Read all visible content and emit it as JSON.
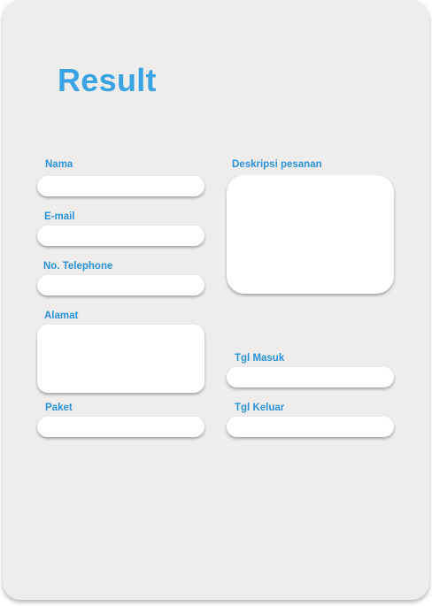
{
  "page": {
    "title": "Result"
  },
  "form": {
    "nama": {
      "label": "Nama",
      "value": ""
    },
    "email": {
      "label": "E-mail",
      "value": ""
    },
    "telephone": {
      "label": "No. Telephone",
      "value": ""
    },
    "alamat": {
      "label": "Alamat",
      "value": ""
    },
    "paket": {
      "label": "Paket",
      "value": ""
    },
    "deskripsi": {
      "label": "Deskripsi pesanan",
      "value": ""
    },
    "tgl_masuk": {
      "label": "Tgl Masuk",
      "value": ""
    },
    "tgl_keluar": {
      "label": "Tgl Keluar",
      "value": ""
    }
  },
  "colors": {
    "accent": "#3aa3e3",
    "label": "#2a93d8",
    "card_background": "#eeedec",
    "field_background": "#ffffff"
  }
}
